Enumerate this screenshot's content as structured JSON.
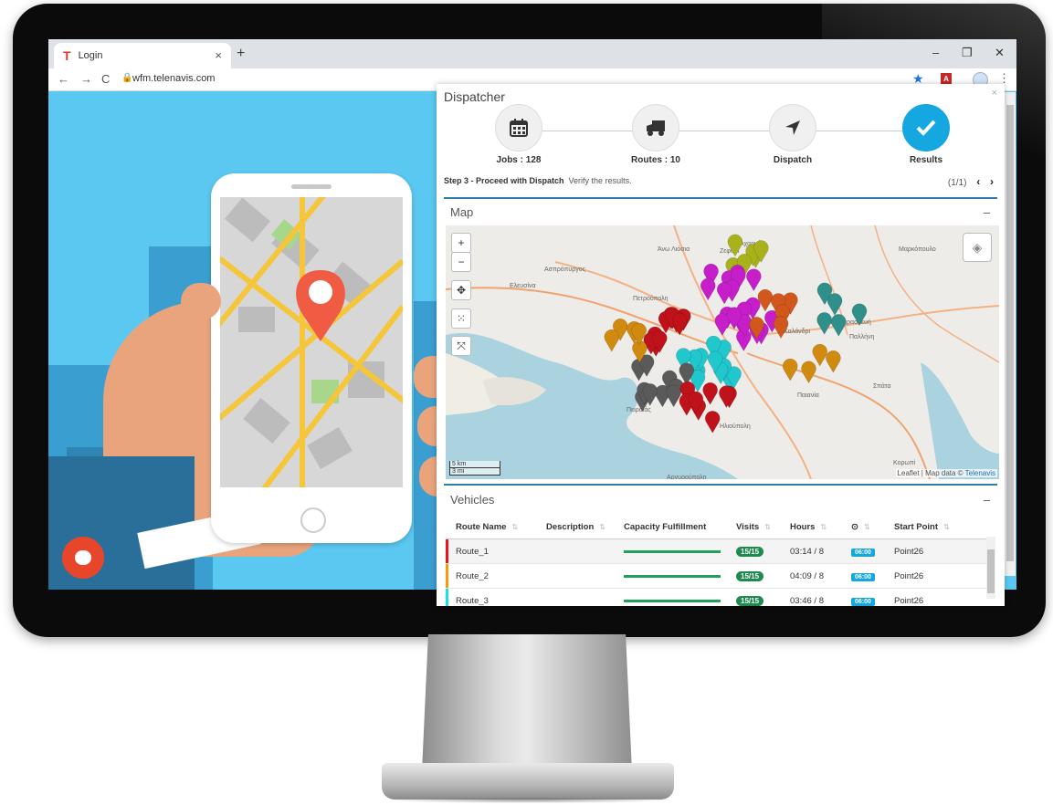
{
  "browser": {
    "tab_title": "Login",
    "tab_close": "×",
    "new_tab": "+",
    "url": "wfm.telenavis.com",
    "window_controls": [
      "–",
      "❐",
      "✕"
    ],
    "nav": [
      "←",
      "→",
      "C"
    ]
  },
  "dispatcher": {
    "title": "Dispatcher",
    "close": "×",
    "steps": [
      {
        "label": "Jobs : 128",
        "icon": "calendar-icon",
        "active": false
      },
      {
        "label": "Routes : 10",
        "icon": "truck-icon",
        "active": false
      },
      {
        "label": "Dispatch",
        "icon": "navigation-arrow-icon",
        "active": false
      },
      {
        "label": "Results",
        "icon": "checkmark-icon",
        "active": true
      }
    ],
    "step_title": "Step 3 - Proceed with Dispatch",
    "step_hint": "Verify the results.",
    "pager": "(1/1)",
    "prev": "‹",
    "next": "›",
    "map_section": "Map",
    "map_minimize": "–",
    "zoom_in": "+",
    "zoom_out": "−",
    "scale_km": "5 km",
    "scale_mi": "3 mi",
    "attribution_a": "Leaflet | Map data ©",
    "attribution_b": "Telenavis",
    "vehicles_section": "Vehicles",
    "vehicles_minimize": "–",
    "columns": [
      "Route Name",
      "Description",
      "Capacity Fulfillment",
      "Visits",
      "Hours",
      "⊙",
      "Start Point"
    ],
    "rows": [
      {
        "color": "#e8141b",
        "name": "Route_1",
        "description": "",
        "capacity": 1.0,
        "visits": "15/15",
        "hours": "03:14 / 8",
        "start": "06:00",
        "start_point": "Point26"
      },
      {
        "color": "#f59a0c",
        "name": "Route_2",
        "description": "",
        "capacity": 1.0,
        "visits": "15/15",
        "hours": "04:09 / 8",
        "start": "06:00",
        "start_point": "Point26"
      },
      {
        "color": "#17e0e8",
        "name": "Route_3",
        "description": "",
        "capacity": 1.0,
        "visits": "15/15",
        "hours": "03:46 / 8",
        "start": "06:00",
        "start_point": "Point26"
      }
    ]
  },
  "map_labels": [
    "Άνω Λιόσια",
    "Αχαρνές",
    "Ασπρόπυργος",
    "Ελευσίνα",
    "Πετρούπολη",
    "Πειραιάς",
    "Χαλάνδρι",
    "Μαρκόπουλο",
    "Παιανία",
    "Σπάτα",
    "Κορωπί",
    "Ζεφύρι",
    "Αγ. Παρασκευή",
    "Παλλήνη",
    "Ηλιούπολη",
    "Αργυρούπολη"
  ],
  "colors": {
    "accent": "#15a7e0",
    "section_line": "#2d7fa8",
    "success": "#1d8a4e"
  }
}
